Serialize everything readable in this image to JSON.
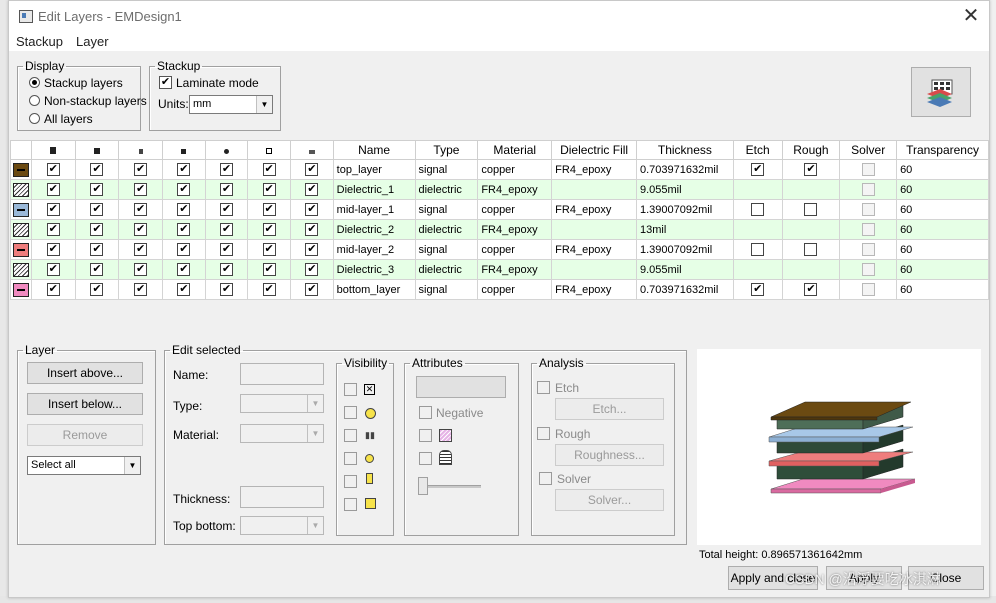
{
  "window": {
    "title": "Edit Layers - EMDesign1",
    "close_glyph": "✕"
  },
  "menu": {
    "stackup": "Stackup",
    "layer": "Layer"
  },
  "display": {
    "legend": "Display",
    "options": [
      {
        "label": "Stackup layers",
        "selected": true
      },
      {
        "label": "Non-stackup layers",
        "selected": false
      },
      {
        "label": "All layers",
        "selected": false
      }
    ]
  },
  "stackup": {
    "legend": "Stackup",
    "laminate_label": "Laminate mode",
    "laminate_checked": true,
    "units_label": "Units:",
    "units_value": "mm"
  },
  "table": {
    "headers": [
      "Name",
      "Type",
      "Material",
      "Dielectric Fill",
      "Thickness",
      "Etch",
      "Rough",
      "Solver",
      "Transparency"
    ],
    "rows": [
      {
        "color": "#6b4a12",
        "hatch": false,
        "name": "top_layer",
        "type": "signal",
        "material": "copper",
        "fill": "FR4_epoxy",
        "thickness": "0.703971632mil",
        "etch": "checked",
        "rough": "checked",
        "solver": "disabled",
        "transparency": "60",
        "dielectric": false
      },
      {
        "color": "#6b8a5a",
        "hatch": true,
        "name": "Dielectric_1",
        "type": "dielectric",
        "material": "FR4_epoxy",
        "fill": "",
        "thickness": "9.055mil",
        "etch": "none",
        "rough": "none",
        "solver": "disabled",
        "transparency": "60",
        "dielectric": true
      },
      {
        "color": "#9ab8d8",
        "hatch": false,
        "name": "mid-layer_1",
        "type": "signal",
        "material": "copper",
        "fill": "FR4_epoxy",
        "thickness": "1.39007092mil",
        "etch": "unchecked",
        "rough": "unchecked",
        "solver": "disabled",
        "transparency": "60",
        "dielectric": false
      },
      {
        "color": "#2e4a38",
        "hatch": true,
        "name": "Dielectric_2",
        "type": "dielectric",
        "material": "FR4_epoxy",
        "fill": "",
        "thickness": "13mil",
        "etch": "none",
        "rough": "none",
        "solver": "disabled",
        "transparency": "60",
        "dielectric": true
      },
      {
        "color": "#ee7d7d",
        "hatch": false,
        "name": "mid-layer_2",
        "type": "signal",
        "material": "copper",
        "fill": "FR4_epoxy",
        "thickness": "1.39007092mil",
        "etch": "unchecked",
        "rough": "unchecked",
        "solver": "disabled",
        "transparency": "60",
        "dielectric": false
      },
      {
        "color": "#3a5a3a",
        "hatch": true,
        "name": "Dielectric_3",
        "type": "dielectric",
        "material": "FR4_epoxy",
        "fill": "",
        "thickness": "9.055mil",
        "etch": "none",
        "rough": "none",
        "solver": "disabled",
        "transparency": "60",
        "dielectric": true
      },
      {
        "color": "#f08ac0",
        "hatch": false,
        "name": "bottom_layer",
        "type": "signal",
        "material": "copper",
        "fill": "FR4_epoxy",
        "thickness": "0.703971632mil",
        "etch": "checked",
        "rough": "checked",
        "solver": "disabled",
        "transparency": "60",
        "dielectric": false
      }
    ]
  },
  "layer_panel": {
    "legend": "Layer",
    "insert_above": "Insert above...",
    "insert_below": "Insert below...",
    "remove": "Remove",
    "select_value": "Select all"
  },
  "edit_selected": {
    "legend": "Edit selected",
    "name": "Name:",
    "type": "Type:",
    "material": "Material:",
    "thickness": "Thickness:",
    "top_bottom": "Top bottom:"
  },
  "visibility": {
    "legend": "Visibility"
  },
  "attributes": {
    "legend": "Attributes",
    "negative": "Negative"
  },
  "analysis": {
    "legend": "Analysis",
    "etch": "Etch",
    "etch_btn": "Etch...",
    "rough": "Rough",
    "rough_btn": "Roughness...",
    "solver": "Solver",
    "solver_btn": "Solver..."
  },
  "preview": {
    "total_height": "Total height: 0.896571361642mm"
  },
  "footer": {
    "apply_close": "Apply and close",
    "apply": "Apply",
    "close": "Close"
  },
  "watermark": "CSDN @沿浮要吃冰淇淋"
}
